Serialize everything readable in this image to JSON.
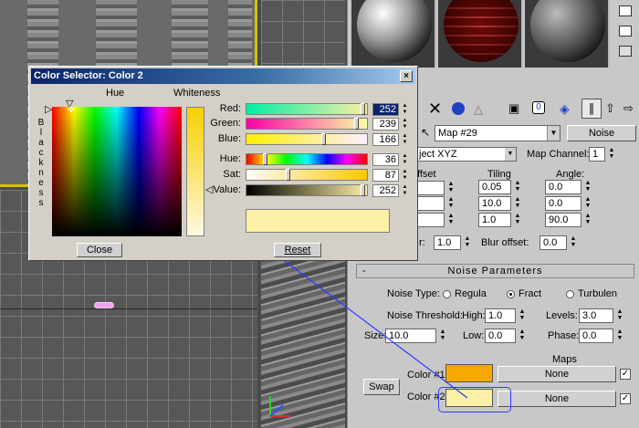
{
  "dialog": {
    "title": "Color Selector: Color 2",
    "close_glyph": "×",
    "hue_label": "Hue",
    "whiteness_label": "Whiteness",
    "blackness_letters": [
      "B",
      "l",
      "a",
      "c",
      "k",
      "n",
      "e",
      "s",
      "s"
    ],
    "rows": [
      {
        "label": "Red:",
        "value": "252",
        "fraction": 0.99
      },
      {
        "label": "Green:",
        "value": "239",
        "fraction": 0.94
      },
      {
        "label": "Blue:",
        "value": "166",
        "fraction": 0.65
      },
      {
        "label": "Hue:",
        "value": "36",
        "fraction": 0.14
      },
      {
        "label": "Sat:",
        "value": "87",
        "fraction": 0.34
      },
      {
        "label": "Value:",
        "value": "252",
        "fraction": 0.99
      }
    ],
    "swatch_color": "#fcefa6",
    "close_button": "Close",
    "reset_button": "Reset"
  },
  "toolbar": {
    "map_name": "Map #29",
    "map_type_button": "Noise",
    "mapping_value": "ject XYZ",
    "map_channel_label": "Map Channel:",
    "map_channel_value": "1"
  },
  "coords": {
    "offset_label": "ffset",
    "tiling_label": "Tiling",
    "angle_label": "Angle:",
    "tiling": [
      "0.05",
      "10.0",
      "1.0"
    ],
    "angle": [
      "0.0",
      "0.0",
      "90.0"
    ],
    "blur_label": "r:",
    "blur_value": "1.0",
    "blur_offset_label": "Blur offset:",
    "blur_offset_value": "0.0"
  },
  "noise": {
    "rollout_title": "Noise Parameters",
    "rollout_toggle": "-",
    "noise_type_label": "Noise Type:",
    "types": [
      "Regula",
      "Fract",
      "Turbulen"
    ],
    "selected_type": "Fract",
    "threshold_label": "Noise Threshold:",
    "high_label": "High:",
    "high_value": "1.0",
    "levels_label": "Levels:",
    "levels_value": "3.0",
    "size_label": "Size:",
    "size_value": "10.0",
    "low_label": "Low:",
    "low_value": "0.0",
    "phase_label": "Phase:",
    "phase_value": "0.0",
    "maps_label": "Maps",
    "color1_label": "Color #1",
    "color1": "#f4a800",
    "color1_map": "None",
    "color2_label": "Color #2",
    "color2": "#fcefa6",
    "color2_map": "None",
    "swap_button": "Swap"
  },
  "colors": {
    "highlight": "#2a3cff",
    "viewport_active": "#d8c000"
  }
}
